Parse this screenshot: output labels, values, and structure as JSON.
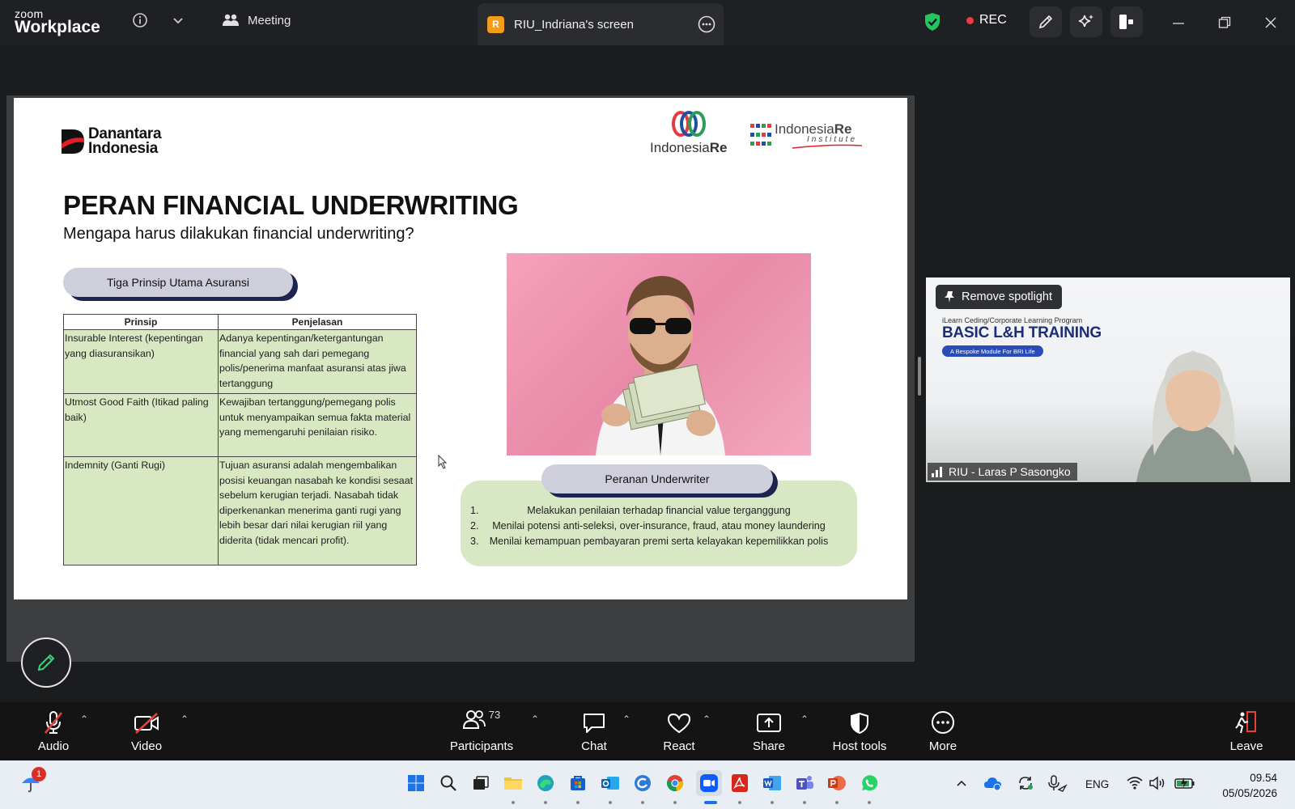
{
  "titlebar": {
    "app_top": "zoom",
    "app_name": "Workplace",
    "meeting_tab": "Meeting",
    "screen_badge": "R",
    "screen_tab": "RIU_Indriana's screen",
    "rec_label": "REC",
    "shield_color": "#22c55e",
    "rec_color": "#f2393f"
  },
  "slide": {
    "org_logo_line1": "Danantara",
    "org_logo_line2": "Indonesia",
    "ire_logo_a": "Indonesia",
    "ire_logo_b": "Re",
    "iri_logo_a": "Indonesia",
    "iri_logo_b": "Re",
    "iri_logo_sub": "Institute",
    "title": "PERAN FINANCIAL UNDERWRITING",
    "subtitle": "Mengapa harus dilakukan financial underwriting?",
    "principles_pill": "Tiga Prinsip Utama Asuransi",
    "table": {
      "headers": [
        "Prinsip",
        "Penjelasan"
      ],
      "rows": [
        {
          "prinsip": "Insurable Interest (kepentingan yang diasuransikan)",
          "penjelasan": "Adanya kepentingan/ketergantungan financial yang sah dari pemegang polis/penerima manfaat asuransi atas jiwa tertanggung"
        },
        {
          "prinsip": "Utmost Good Faith (Itikad paling baik)",
          "penjelasan": "Kewajiban tertanggung/pemegang polis untuk menyampaikan semua fakta material yang memengaruhi penilaian risiko."
        },
        {
          "prinsip": "Indemnity (Ganti Rugi)",
          "penjelasan": "Tujuan asuransi adalah mengembalikan posisi keuangan nasabah ke kondisi sesaat sebelum kerugian terjadi. Nasabah tidak diperkenankan menerima ganti rugi yang lebih besar dari nilai kerugian riil yang diderita (tidak mencari profit)."
        }
      ]
    },
    "roles_pill": "Peranan Underwriter",
    "roles": [
      {
        "num": "1.",
        "text": "Melakukan penilaian terhadap financial value terganggung"
      },
      {
        "num": "2.",
        "text": "Menilai potensi anti-seleksi, over-insurance, fraud, atau money laundering"
      },
      {
        "num": "3.",
        "text": "Menilai kemampuan pembayaran premi serta kelayakan kepemilikkan polis"
      }
    ]
  },
  "video": {
    "spotlight_label": "Remove spotlight",
    "bg_small": "iLearn Ceding/Corporate Learning Program",
    "bg_title": "BASIC L&H TRAINING",
    "bg_pill": "A Bespoke Module For BRI Life",
    "participant_name": "RIU - Laras P Sasongko"
  },
  "toolbar": {
    "audio": "Audio",
    "video": "Video",
    "participants": "Participants",
    "participants_count": "73",
    "chat": "Chat",
    "react": "React",
    "share": "Share",
    "host_tools": "Host tools",
    "more": "More",
    "leave": "Leave"
  },
  "taskbar": {
    "notification_count": "1",
    "lang": "ENG",
    "time": "09.54",
    "date": "05/05/2026"
  }
}
